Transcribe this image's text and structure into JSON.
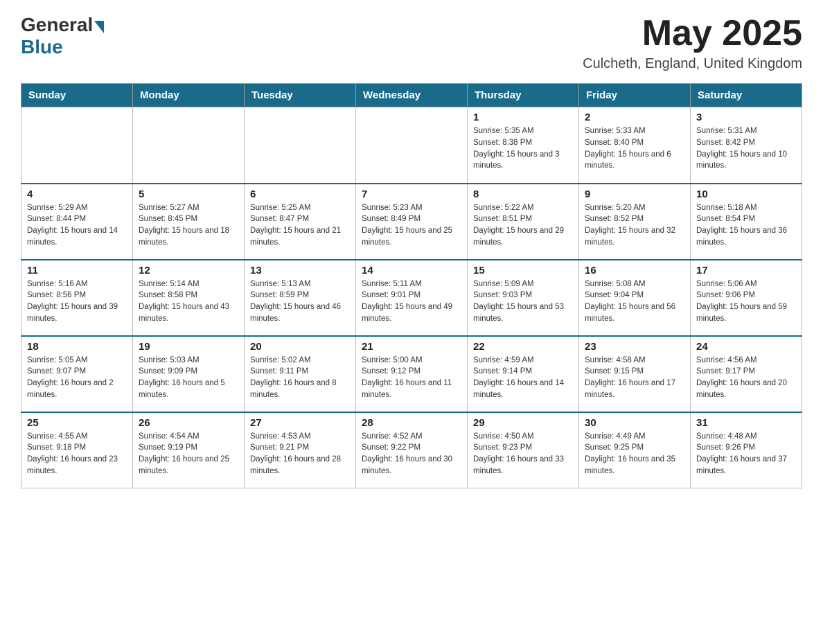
{
  "header": {
    "logo_general": "General",
    "logo_blue": "Blue",
    "month": "May 2025",
    "location": "Culcheth, England, United Kingdom"
  },
  "days": [
    "Sunday",
    "Monday",
    "Tuesday",
    "Wednesday",
    "Thursday",
    "Friday",
    "Saturday"
  ],
  "weeks": [
    [
      {
        "day": "",
        "sunrise": "",
        "sunset": "",
        "daylight": ""
      },
      {
        "day": "",
        "sunrise": "",
        "sunset": "",
        "daylight": ""
      },
      {
        "day": "",
        "sunrise": "",
        "sunset": "",
        "daylight": ""
      },
      {
        "day": "",
        "sunrise": "",
        "sunset": "",
        "daylight": ""
      },
      {
        "day": "1",
        "sunrise": "Sunrise: 5:35 AM",
        "sunset": "Sunset: 8:38 PM",
        "daylight": "Daylight: 15 hours and 3 minutes."
      },
      {
        "day": "2",
        "sunrise": "Sunrise: 5:33 AM",
        "sunset": "Sunset: 8:40 PM",
        "daylight": "Daylight: 15 hours and 6 minutes."
      },
      {
        "day": "3",
        "sunrise": "Sunrise: 5:31 AM",
        "sunset": "Sunset: 8:42 PM",
        "daylight": "Daylight: 15 hours and 10 minutes."
      }
    ],
    [
      {
        "day": "4",
        "sunrise": "Sunrise: 5:29 AM",
        "sunset": "Sunset: 8:44 PM",
        "daylight": "Daylight: 15 hours and 14 minutes."
      },
      {
        "day": "5",
        "sunrise": "Sunrise: 5:27 AM",
        "sunset": "Sunset: 8:45 PM",
        "daylight": "Daylight: 15 hours and 18 minutes."
      },
      {
        "day": "6",
        "sunrise": "Sunrise: 5:25 AM",
        "sunset": "Sunset: 8:47 PM",
        "daylight": "Daylight: 15 hours and 21 minutes."
      },
      {
        "day": "7",
        "sunrise": "Sunrise: 5:23 AM",
        "sunset": "Sunset: 8:49 PM",
        "daylight": "Daylight: 15 hours and 25 minutes."
      },
      {
        "day": "8",
        "sunrise": "Sunrise: 5:22 AM",
        "sunset": "Sunset: 8:51 PM",
        "daylight": "Daylight: 15 hours and 29 minutes."
      },
      {
        "day": "9",
        "sunrise": "Sunrise: 5:20 AM",
        "sunset": "Sunset: 8:52 PM",
        "daylight": "Daylight: 15 hours and 32 minutes."
      },
      {
        "day": "10",
        "sunrise": "Sunrise: 5:18 AM",
        "sunset": "Sunset: 8:54 PM",
        "daylight": "Daylight: 15 hours and 36 minutes."
      }
    ],
    [
      {
        "day": "11",
        "sunrise": "Sunrise: 5:16 AM",
        "sunset": "Sunset: 8:56 PM",
        "daylight": "Daylight: 15 hours and 39 minutes."
      },
      {
        "day": "12",
        "sunrise": "Sunrise: 5:14 AM",
        "sunset": "Sunset: 8:58 PM",
        "daylight": "Daylight: 15 hours and 43 minutes."
      },
      {
        "day": "13",
        "sunrise": "Sunrise: 5:13 AM",
        "sunset": "Sunset: 8:59 PM",
        "daylight": "Daylight: 15 hours and 46 minutes."
      },
      {
        "day": "14",
        "sunrise": "Sunrise: 5:11 AM",
        "sunset": "Sunset: 9:01 PM",
        "daylight": "Daylight: 15 hours and 49 minutes."
      },
      {
        "day": "15",
        "sunrise": "Sunrise: 5:09 AM",
        "sunset": "Sunset: 9:03 PM",
        "daylight": "Daylight: 15 hours and 53 minutes."
      },
      {
        "day": "16",
        "sunrise": "Sunrise: 5:08 AM",
        "sunset": "Sunset: 9:04 PM",
        "daylight": "Daylight: 15 hours and 56 minutes."
      },
      {
        "day": "17",
        "sunrise": "Sunrise: 5:06 AM",
        "sunset": "Sunset: 9:06 PM",
        "daylight": "Daylight: 15 hours and 59 minutes."
      }
    ],
    [
      {
        "day": "18",
        "sunrise": "Sunrise: 5:05 AM",
        "sunset": "Sunset: 9:07 PM",
        "daylight": "Daylight: 16 hours and 2 minutes."
      },
      {
        "day": "19",
        "sunrise": "Sunrise: 5:03 AM",
        "sunset": "Sunset: 9:09 PM",
        "daylight": "Daylight: 16 hours and 5 minutes."
      },
      {
        "day": "20",
        "sunrise": "Sunrise: 5:02 AM",
        "sunset": "Sunset: 9:11 PM",
        "daylight": "Daylight: 16 hours and 8 minutes."
      },
      {
        "day": "21",
        "sunrise": "Sunrise: 5:00 AM",
        "sunset": "Sunset: 9:12 PM",
        "daylight": "Daylight: 16 hours and 11 minutes."
      },
      {
        "day": "22",
        "sunrise": "Sunrise: 4:59 AM",
        "sunset": "Sunset: 9:14 PM",
        "daylight": "Daylight: 16 hours and 14 minutes."
      },
      {
        "day": "23",
        "sunrise": "Sunrise: 4:58 AM",
        "sunset": "Sunset: 9:15 PM",
        "daylight": "Daylight: 16 hours and 17 minutes."
      },
      {
        "day": "24",
        "sunrise": "Sunrise: 4:56 AM",
        "sunset": "Sunset: 9:17 PM",
        "daylight": "Daylight: 16 hours and 20 minutes."
      }
    ],
    [
      {
        "day": "25",
        "sunrise": "Sunrise: 4:55 AM",
        "sunset": "Sunset: 9:18 PM",
        "daylight": "Daylight: 16 hours and 23 minutes."
      },
      {
        "day": "26",
        "sunrise": "Sunrise: 4:54 AM",
        "sunset": "Sunset: 9:19 PM",
        "daylight": "Daylight: 16 hours and 25 minutes."
      },
      {
        "day": "27",
        "sunrise": "Sunrise: 4:53 AM",
        "sunset": "Sunset: 9:21 PM",
        "daylight": "Daylight: 16 hours and 28 minutes."
      },
      {
        "day": "28",
        "sunrise": "Sunrise: 4:52 AM",
        "sunset": "Sunset: 9:22 PM",
        "daylight": "Daylight: 16 hours and 30 minutes."
      },
      {
        "day": "29",
        "sunrise": "Sunrise: 4:50 AM",
        "sunset": "Sunset: 9:23 PM",
        "daylight": "Daylight: 16 hours and 33 minutes."
      },
      {
        "day": "30",
        "sunrise": "Sunrise: 4:49 AM",
        "sunset": "Sunset: 9:25 PM",
        "daylight": "Daylight: 16 hours and 35 minutes."
      },
      {
        "day": "31",
        "sunrise": "Sunrise: 4:48 AM",
        "sunset": "Sunset: 9:26 PM",
        "daylight": "Daylight: 16 hours and 37 minutes."
      }
    ]
  ]
}
